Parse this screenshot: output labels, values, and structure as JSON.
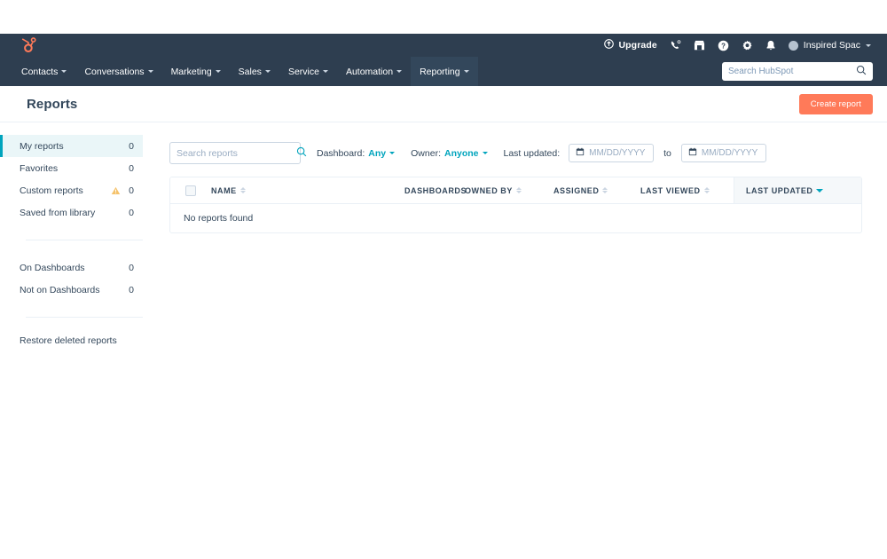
{
  "topbar": {
    "logo_icon": "hubspot-sprocket-logo",
    "upgrade_label": "Upgrade",
    "upgrade_icon": "upgrade-arrow-icon",
    "icons": [
      {
        "name": "phone-icon",
        "label": "Calling"
      },
      {
        "name": "marketplace-icon",
        "label": "Marketplace"
      },
      {
        "name": "help-icon",
        "label": "Help"
      },
      {
        "name": "gear-icon",
        "label": "Settings"
      },
      {
        "name": "bell-icon",
        "label": "Notifications"
      }
    ],
    "account_name": "Inspired Spac"
  },
  "nav": {
    "items": [
      {
        "label": "Contacts",
        "active": false
      },
      {
        "label": "Conversations",
        "active": false
      },
      {
        "label": "Marketing",
        "active": false
      },
      {
        "label": "Sales",
        "active": false
      },
      {
        "label": "Service",
        "active": false
      },
      {
        "label": "Automation",
        "active": false
      },
      {
        "label": "Reporting",
        "active": true
      }
    ],
    "search_placeholder": "Search HubSpot",
    "search_value": "",
    "search_icon": "search-icon"
  },
  "header": {
    "title": "Reports",
    "create_button": "Create report"
  },
  "sidebar": {
    "items": [
      {
        "label": "My reports",
        "count": "0",
        "selected": true,
        "warning": false
      },
      {
        "label": "Favorites",
        "count": "0",
        "selected": false,
        "warning": false
      },
      {
        "label": "Custom reports",
        "count": "0",
        "selected": false,
        "warning": true
      },
      {
        "label": "Saved from library",
        "count": "0",
        "selected": false,
        "warning": false
      }
    ],
    "group2": [
      {
        "label": "On Dashboards",
        "count": "0"
      },
      {
        "label": "Not on Dashboards",
        "count": "0"
      }
    ],
    "restore_link": "Restore deleted reports",
    "warning_icon": "warning-triangle-icon"
  },
  "filters": {
    "search_placeholder": "Search reports",
    "search_value": "",
    "search_icon": "search-icon",
    "dashboard_label": "Dashboard:",
    "dashboard_value": "Any",
    "owner_label": "Owner:",
    "owner_value": "Anyone",
    "last_updated_label": "Last updated:",
    "date_from_placeholder": "MM/DD/YYYY",
    "date_from_value": "",
    "date_to_placeholder": "MM/DD/YYYY",
    "date_to_value": "",
    "to_label": "to",
    "calendar_icon": "calendar-icon"
  },
  "table": {
    "columns": [
      {
        "label": "NAME",
        "sortable": true,
        "active": false
      },
      {
        "label": "DASHBOARDS",
        "sortable": false,
        "active": false
      },
      {
        "label": "OWNED BY",
        "sortable": true,
        "active": false
      },
      {
        "label": "ASSIGNED",
        "sortable": true,
        "active": false
      },
      {
        "label": "LAST VIEWED",
        "sortable": true,
        "active": false
      },
      {
        "label": "LAST UPDATED",
        "sortable": true,
        "active": true
      }
    ],
    "rows": [],
    "empty_message": "No reports found",
    "select_all_checked": false
  },
  "colors": {
    "navy": "#2e3e50",
    "nav_active": "#33475b",
    "orange": "#ff7a59",
    "teal": "#00a4bd",
    "selected_bg": "#eaf6f8",
    "warning": "#f5c26b",
    "border": "#eaf0f6"
  }
}
